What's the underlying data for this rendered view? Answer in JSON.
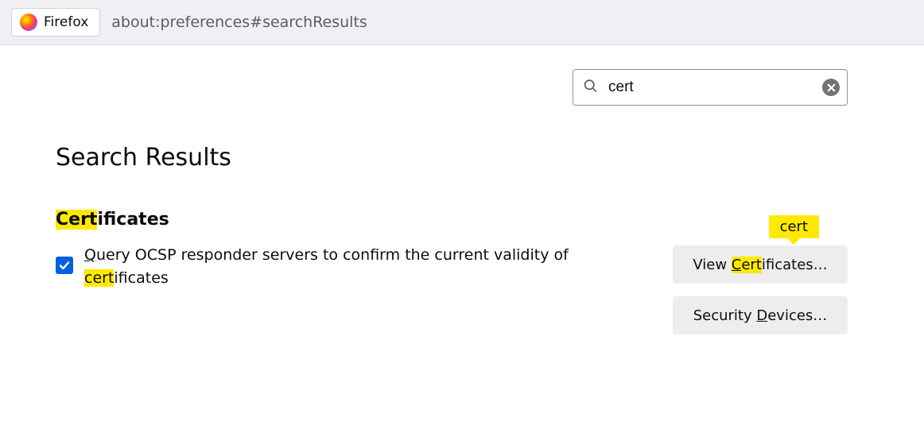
{
  "topbar": {
    "app_name": "Firefox",
    "url": "about:preferences#searchResults"
  },
  "search": {
    "value": "cert"
  },
  "page": {
    "title": "Search Results"
  },
  "section": {
    "heading_hl": "Cert",
    "heading_rest": "ificates",
    "checkbox_checked": true,
    "option_pre_q": "Q",
    "option_text1": "uery OCSP responder servers to confirm the current validity of ",
    "option_hl": "cert",
    "option_text2": "ificates"
  },
  "tooltip": {
    "text": "cert"
  },
  "buttons": {
    "view_pre": "View ",
    "view_c": "C",
    "view_mid": "ert",
    "view_post": "ificates…",
    "security_pre": "Security ",
    "security_d": "D",
    "security_post": "evices…"
  }
}
